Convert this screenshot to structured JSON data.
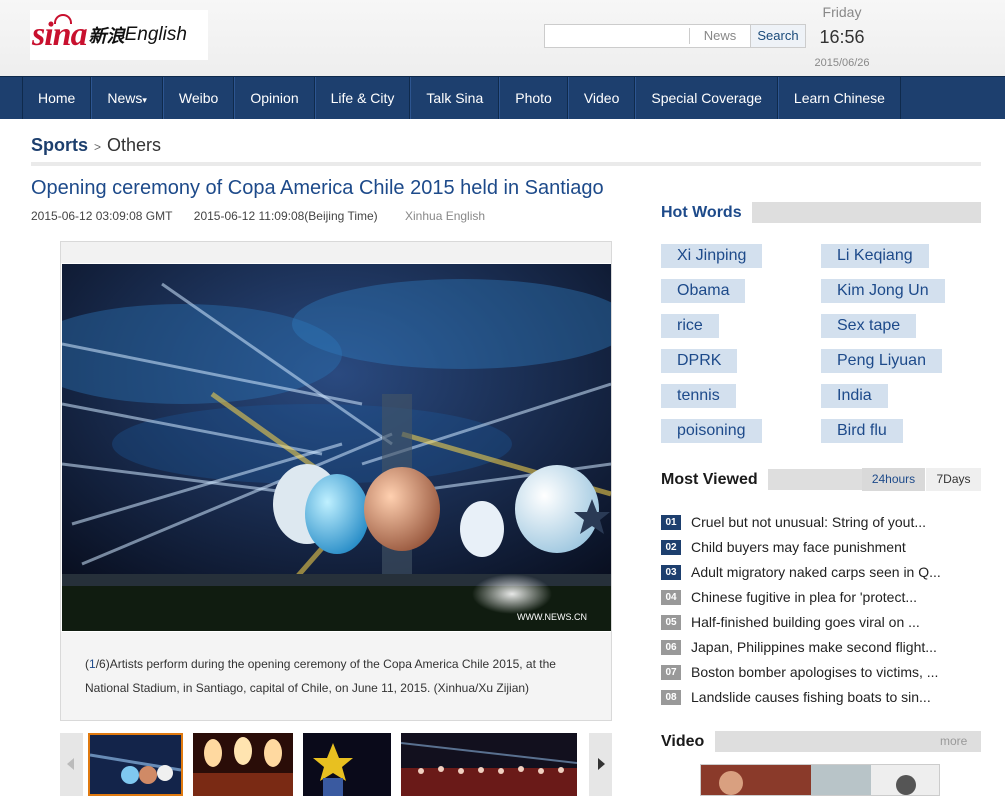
{
  "brand": {
    "logo_text": "sina",
    "logo_cn": "新浪",
    "logo_en": "English"
  },
  "search": {
    "placeholder": "",
    "category": "News",
    "button": "Search"
  },
  "datetime": {
    "day": "Friday",
    "time": "16:56",
    "date": "2015/06/26"
  },
  "nav": [
    {
      "label": "Home"
    },
    {
      "label": "News",
      "has_dropdown": true
    },
    {
      "label": "Weibo"
    },
    {
      "label": "Opinion"
    },
    {
      "label": "Life & City"
    },
    {
      "label": "Talk Sina"
    },
    {
      "label": "Photo"
    },
    {
      "label": "Video"
    },
    {
      "label": "Special Coverage"
    },
    {
      "label": "Learn Chinese"
    }
  ],
  "breadcrumb": {
    "section": "Sports",
    "separator": ">",
    "subsection": "Others"
  },
  "article": {
    "title": "Opening ceremony of Copa America Chile 2015 held in Santiago",
    "gmt": "2015-06-12 03:09:08 GMT",
    "beijing": "2015-06-12 11:09:08(Beijing Time)",
    "source": "Xinhua English",
    "photo_watermark": "WWW.NEWS.CN",
    "caption_open": "(",
    "caption_index": "1",
    "caption_total": "/6)",
    "caption_text": "Artists perform during the opening ceremony of the Copa America Chile 2015, at the National Stadium, in Santiago, capital of Chile, on June 11, 2015. (Xinhua/Xu Zijian)"
  },
  "colors": {
    "nav_bg": "#1d3f6e",
    "link": "#1d4a8a",
    "hot_word_bg": "#d3e0ee",
    "rank_top": "#1d3f6e",
    "rank_other": "#999999"
  },
  "hot_words": {
    "title": "Hot Words",
    "left": [
      "Xi Jinping",
      "Obama",
      "rice",
      "DPRK",
      "tennis",
      "poisoning"
    ],
    "right": [
      "Li Keqiang",
      "Kim Jong Un",
      "Sex tape",
      "Peng Liyuan",
      "India",
      "Bird flu"
    ]
  },
  "most_viewed": {
    "title": "Most Viewed",
    "tabs": [
      "24hours",
      "7Days"
    ],
    "active_tab": "24hours",
    "items": [
      {
        "num": "01",
        "text": "Cruel but not unusual: String of yout..."
      },
      {
        "num": "02",
        "text": "Child buyers may face punishment"
      },
      {
        "num": "03",
        "text": "Adult migratory naked carps seen in Q..."
      },
      {
        "num": "04",
        "text": "Chinese fugitive in plea for 'protect..."
      },
      {
        "num": "05",
        "text": "Half-finished building goes viral on ..."
      },
      {
        "num": "06",
        "text": "Japan, Philippines make second flight..."
      },
      {
        "num": "07",
        "text": "Boston bomber apologises to victims, ..."
      },
      {
        "num": "08",
        "text": "Landslide causes fishing boats to sin..."
      }
    ]
  },
  "video": {
    "title": "Video",
    "more": "more"
  }
}
